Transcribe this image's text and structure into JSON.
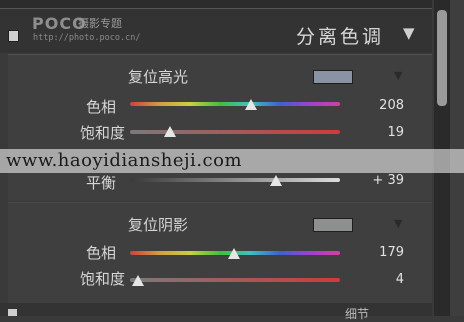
{
  "header": {
    "logo_main": "POCO",
    "logo_sub": "摄影专题",
    "logo_url": "http://photo.poco.cn/",
    "panel_title": "分离色调",
    "collapse_icon": "triangle-down-icon"
  },
  "highlights": {
    "title": "复位高光",
    "swatch_color": "#8a93a3",
    "rows": [
      {
        "label": "色相",
        "value": "208",
        "fraction": 0.578,
        "kind": "hue"
      },
      {
        "label": "饱和度",
        "value": "19",
        "fraction": 0.19,
        "kind": "sat"
      }
    ]
  },
  "balance": {
    "label": "平衡",
    "value": "+ 39",
    "fraction": 0.695
  },
  "shadows": {
    "title": "复位阴影",
    "swatch_color": "#8e9090",
    "rows": [
      {
        "label": "色相",
        "value": "179",
        "fraction": 0.497,
        "kind": "hue"
      },
      {
        "label": "饱和度",
        "value": "4",
        "fraction": 0.04,
        "kind": "sat"
      }
    ]
  },
  "watermark": {
    "text": "www.haoyidianshejі.com"
  },
  "bottom": {
    "partial_text": "细节"
  },
  "colors": {
    "panel_bg": "#3f3f3f",
    "header_bg": "#333333",
    "scroll_thumb": "#9a9a9a"
  }
}
